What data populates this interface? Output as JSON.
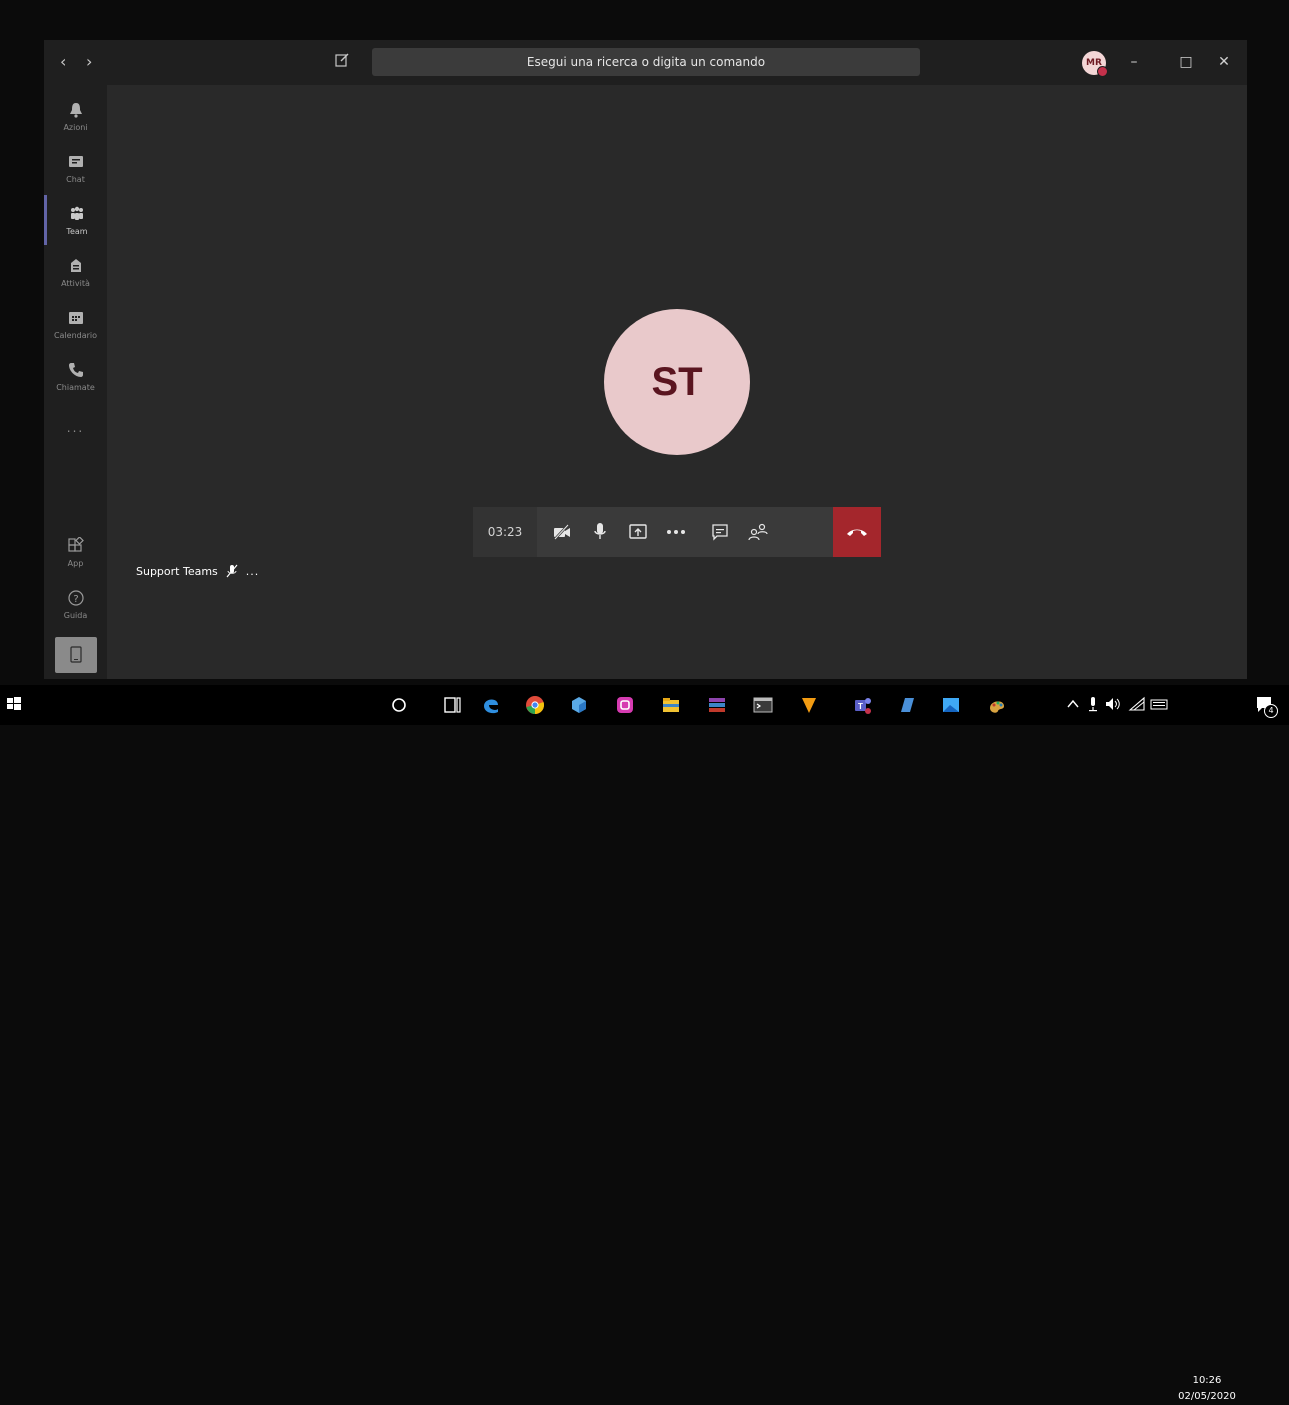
{
  "titlebar": {
    "search_placeholder": "Esegui una ricerca o digita un comando",
    "user_initials": "MR"
  },
  "sidebar": {
    "items": [
      {
        "label": "Azioni",
        "icon": "bell-icon"
      },
      {
        "label": "Chat",
        "icon": "chat-icon"
      },
      {
        "label": "Team",
        "icon": "teams-icon"
      },
      {
        "label": "Attività",
        "icon": "assignments-icon"
      },
      {
        "label": "Calendario",
        "icon": "calendar-icon"
      },
      {
        "label": "Chiamate",
        "icon": "phone-icon"
      }
    ],
    "more": "...",
    "bottom_items": [
      {
        "label": "App",
        "icon": "apps-icon"
      },
      {
        "label": "Guida",
        "icon": "help-icon"
      }
    ]
  },
  "call": {
    "avatar_initials": "ST",
    "timer": "03:23",
    "participant_name": "Support Teams",
    "more": "..."
  },
  "taskbar": {
    "time": "10:26",
    "date": "02/05/2020",
    "notifications": "4"
  },
  "colors": {
    "accent": "#6264a7",
    "hangup": "#a4262c",
    "avatar_bg": "#e9c9cb"
  }
}
